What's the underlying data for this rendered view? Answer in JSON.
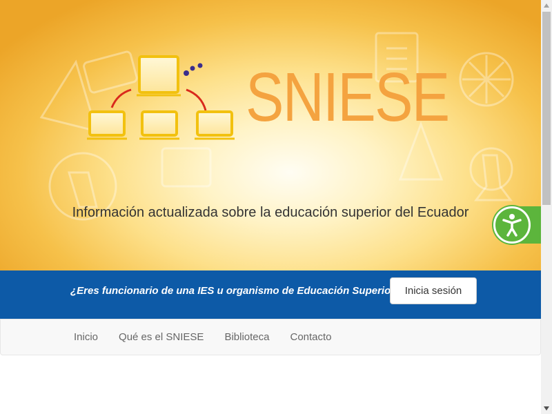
{
  "header": {
    "logo_text": "SNIESE",
    "tagline": "Información actualizada sobre la educación superior del Ecuador"
  },
  "login_bar": {
    "question": "¿Eres funcionario de una IES u organismo de Educación Superior?",
    "button_label": "Inicia sesión"
  },
  "nav": {
    "items": [
      {
        "label": "Inicio"
      },
      {
        "label": "Qué es el SNIESE"
      },
      {
        "label": "Biblioteca"
      },
      {
        "label": "Contacto"
      }
    ]
  },
  "colors": {
    "brand_orange": "#f4a340",
    "login_bar_blue": "#0d5aa7",
    "accessibility_green": "#5cb53c"
  },
  "icons": {
    "logo": "network-computers-icon",
    "accessibility": "accessibility-person-icon"
  }
}
